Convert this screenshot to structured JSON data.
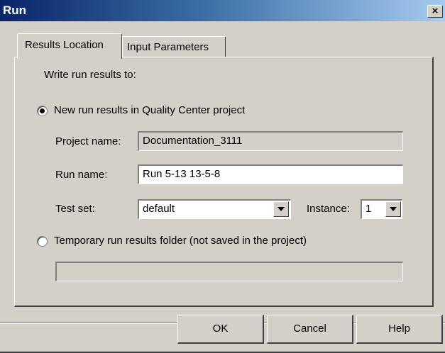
{
  "window": {
    "title": "Run",
    "close_glyph": "×"
  },
  "tabs": [
    {
      "label": "Results Location",
      "active": true
    },
    {
      "label": "Input Parameters",
      "active": false
    }
  ],
  "results": {
    "heading": "Write run results to:",
    "option_new": {
      "label": "New run results in Quality Center project",
      "selected": true
    },
    "project_name": {
      "label": "Project name:",
      "value": "Documentation_3111"
    },
    "run_name": {
      "label": "Run name:",
      "value": "Run 5-13 13-5-8"
    },
    "test_set": {
      "label": "Test set:",
      "value": "default"
    },
    "instance": {
      "label": "Instance:",
      "value": "1"
    },
    "option_temp": {
      "label": "Temporary run results folder (not saved in the project)",
      "selected": false
    },
    "temp_folder": {
      "value": ""
    }
  },
  "buttons": {
    "ok": "OK",
    "cancel": "Cancel",
    "help": "Help"
  }
}
